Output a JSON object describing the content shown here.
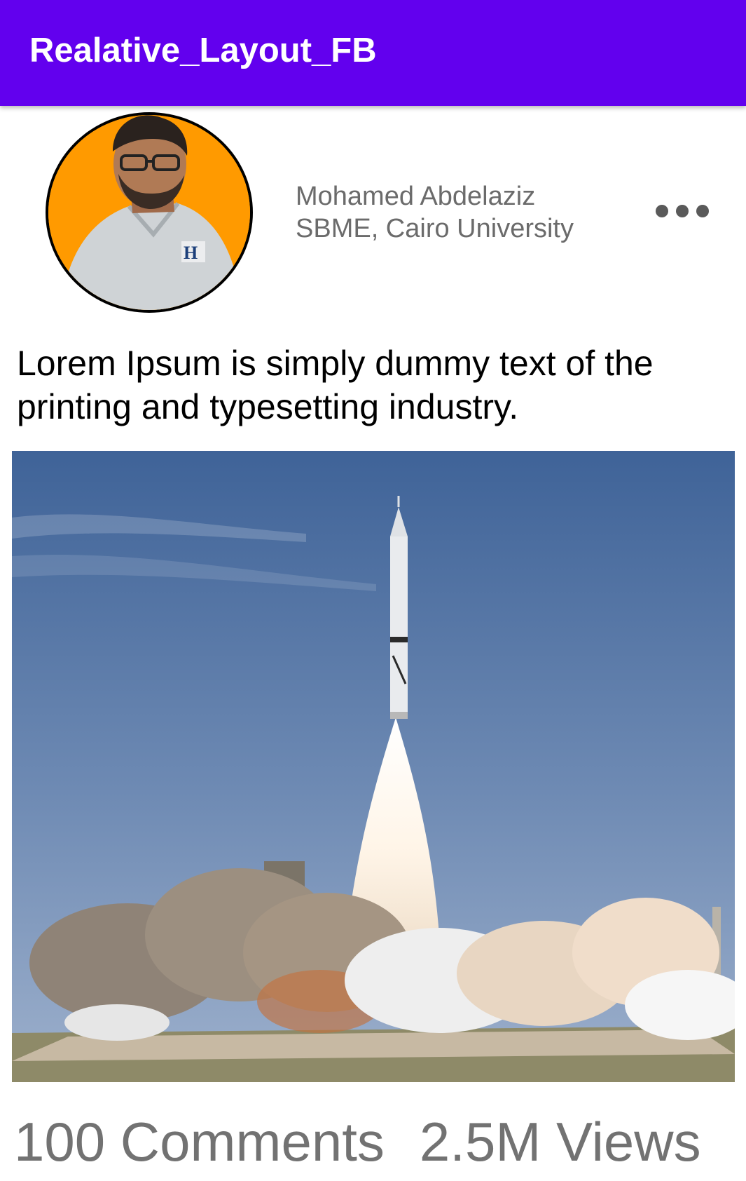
{
  "app_bar": {
    "title": "Realative_Layout_FB",
    "color": "#6200ee"
  },
  "author": {
    "name": "Mohamed Abdelaziz",
    "affiliation": "SBME, Cairo University",
    "avatar_background": "#ff9a00"
  },
  "post": {
    "text": "Lorem Ipsum is simply dummy text of the printing and typesetting industry.",
    "image_icon": "rocket-launch-photo"
  },
  "stats": {
    "comments": "100 Comments",
    "views": "2.5M Views"
  },
  "icons": {
    "more": "more-horizontal-icon"
  }
}
